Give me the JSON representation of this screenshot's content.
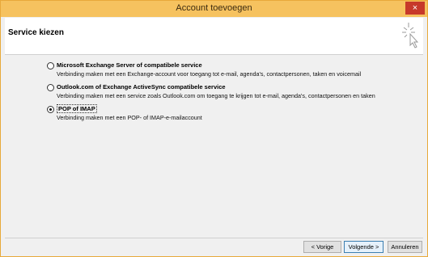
{
  "window": {
    "title": "Account toevoegen",
    "close_label": "×"
  },
  "header": {
    "title": "Service kiezen"
  },
  "options": [
    {
      "title": "Microsoft Exchange Server of compatibele service",
      "description": "Verbinding maken met een Exchange-account voor toegang tot e-mail, agenda's, contactpersonen, taken en voicemail",
      "selected": false
    },
    {
      "title": "Outlook.com of Exchange ActiveSync compatibele service",
      "description": "Verbinding maken met een service zoals Outlook.com om toegang te krijgen tot e-mail, agenda's, contactpersonen en taken",
      "selected": false
    },
    {
      "title": "POP of IMAP",
      "description": "Verbinding maken met een POP- of IMAP-e-mailaccount",
      "selected": true
    }
  ],
  "footer": {
    "back_label": "< Vorige",
    "next_label": "Volgende >",
    "cancel_label": "Annuleren"
  },
  "colors": {
    "titlebar": "#f6c25f",
    "close": "#c7392a",
    "dialog": "#f0f0f0"
  }
}
